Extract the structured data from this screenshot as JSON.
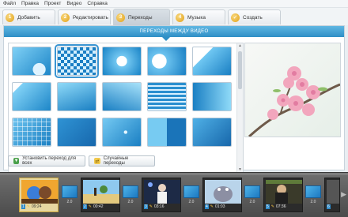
{
  "menu": [
    "Файл",
    "Правка",
    "Проект",
    "Видео",
    "Справка"
  ],
  "tabs": [
    {
      "num": "1",
      "label": "Добавить"
    },
    {
      "num": "2",
      "label": "Редактировать"
    },
    {
      "num": "3",
      "label": "Переходы"
    },
    {
      "num": "4",
      "label": "Музыка"
    },
    {
      "num": "✓",
      "label": "Создать"
    }
  ],
  "panel": {
    "title": "ПЕРЕХОДЫ МЕЖДУ ВИДЕО"
  },
  "buttons": {
    "set_for_all": "Установить переход для всех",
    "random": "Случайные переходы"
  },
  "timeline": {
    "clips": [
      {
        "num": "1",
        "duration": "09:24"
      },
      {
        "num": "2",
        "duration": "00:42"
      },
      {
        "num": "3",
        "duration": "03:16"
      },
      {
        "num": "4",
        "duration": "01:03"
      },
      {
        "num": "5",
        "duration": "07:36"
      },
      {
        "num": "6",
        "duration": ""
      }
    ],
    "transitions": [
      "2.0",
      "2.0",
      "2.0",
      "2.0",
      "2.0"
    ]
  },
  "colors": {
    "accent": "#2f8fc6",
    "badge": "#f0a81d",
    "selection": "#3a95d2"
  }
}
